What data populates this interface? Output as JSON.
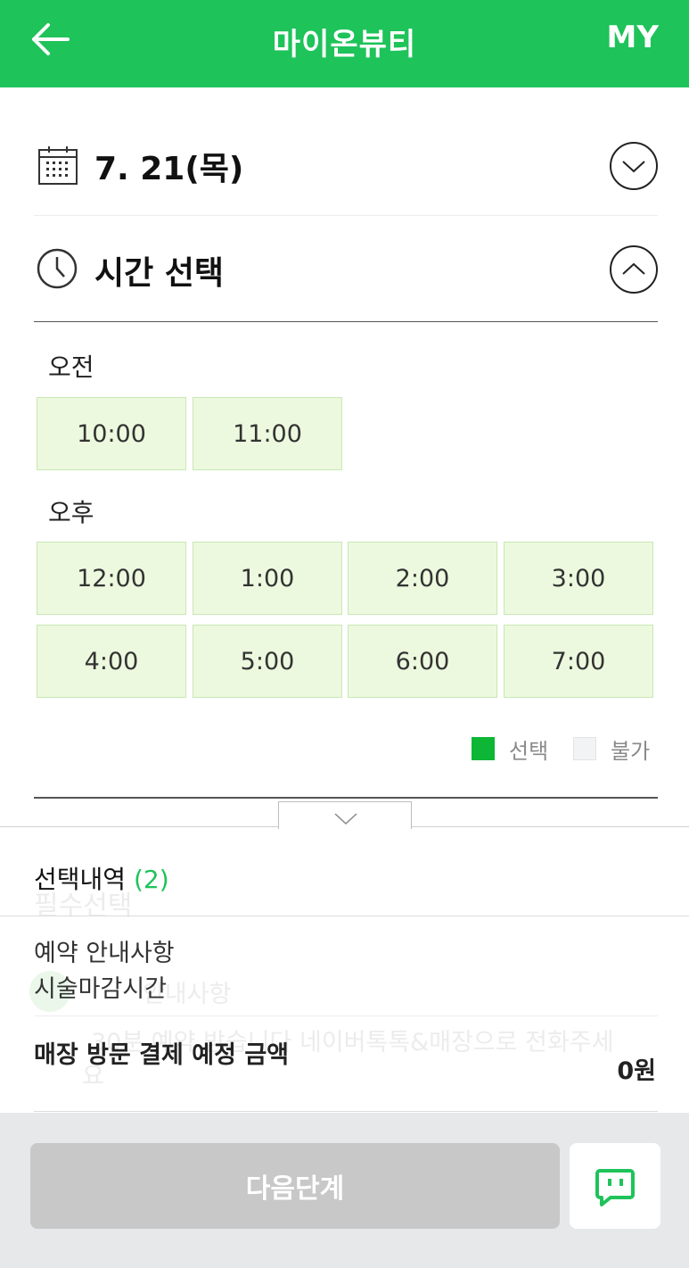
{
  "header": {
    "title": "마이온뷰티",
    "my_label": "MY"
  },
  "date": {
    "label": "7. 21(목)"
  },
  "time": {
    "label": "시간 선택"
  },
  "morning": {
    "label": "오전",
    "slots": [
      "10:00",
      "11:00"
    ]
  },
  "afternoon": {
    "label": "오후",
    "slots": [
      "12:00",
      "1:00",
      "2:00",
      "3:00",
      "4:00",
      "5:00",
      "6:00",
      "7:00"
    ]
  },
  "legend": {
    "selected_label": "선택",
    "unavailable_label": "불가",
    "selected_color": "#0db634",
    "unavailable_color": "#f2f3f4",
    "available_slot_color": "#edf9de"
  },
  "summary": {
    "title": "선택내역",
    "count": "(2)",
    "notice_label": "예약 안내사항",
    "deadline_label": "시술마감시간",
    "payment_label": "매장 방문 결제 예정 금액",
    "payment_amount": "0원"
  },
  "background_text": {
    "required": "필수선택",
    "notice": "안내사항",
    "body_line1": "30분 예약 받습니다 네이버톡톡&매장으로 전화주세",
    "body_line2": "요"
  },
  "footer": {
    "next_label": "다음단계",
    "talk_icon": "talktalk-icon"
  },
  "colors": {
    "brand": "#1ec35a",
    "disabled_button": "#c8c8c8"
  }
}
